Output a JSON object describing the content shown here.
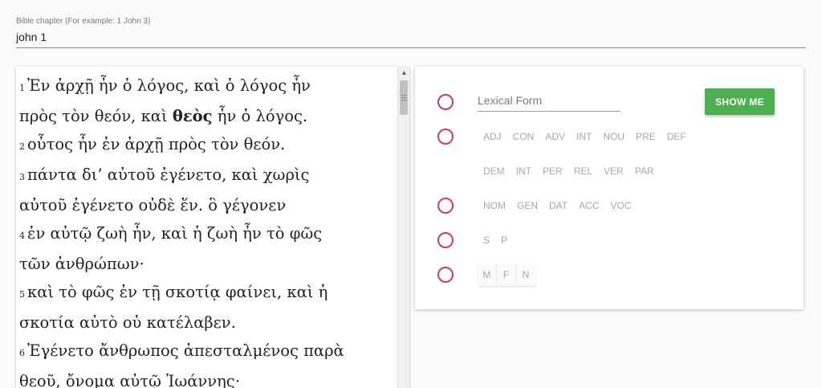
{
  "chapter": {
    "label": "Bible chapter (For example: 1 John 3)",
    "value": "john 1"
  },
  "verses": [
    {
      "number": "1",
      "lines": [
        {
          "words": [
            "Ἐν",
            "ἀρχῇ",
            "ἦν",
            "ὁ",
            "λόγος,",
            "καὶ",
            "ὁ",
            "λόγος",
            "ἦν"
          ]
        },
        {
          "words": [
            "πρὸς",
            "τὸν",
            "θεόν,",
            "καὶ"
          ],
          "bold": "θεὸς",
          "rest": [
            "ἦν",
            "ὁ",
            "λόγος."
          ]
        }
      ]
    },
    {
      "number": "2",
      "lines": [
        {
          "words": [
            "οὗτος",
            "ἦν",
            "ἐν",
            "ἀρχῇ",
            "πρὸς",
            "τὸν",
            "θεόν."
          ]
        }
      ]
    },
    {
      "number": "3",
      "lines": [
        {
          "words": [
            "πάντα",
            "δι’",
            "αὐτοῦ",
            "ἐγένετο,",
            "καὶ",
            "χωρὶς"
          ]
        },
        {
          "words": [
            "αὐτοῦ",
            "ἐγένετο",
            "οὐδὲ",
            "ἕν.",
            "ὃ",
            "γέγονεν"
          ]
        }
      ]
    },
    {
      "number": "4",
      "lines": [
        {
          "words": [
            "ἐν",
            "αὐτῷ",
            "ζωὴ",
            "ἦν,",
            "καὶ",
            "ἡ",
            "ζωὴ",
            "ἦν",
            "τὸ",
            "φῶς"
          ]
        },
        {
          "words": [
            "τῶν",
            "ἀνθρώπων·"
          ]
        }
      ]
    },
    {
      "number": "5",
      "lines": [
        {
          "words": [
            "καὶ",
            "τὸ",
            "φῶς",
            "ἐν",
            "τῇ",
            "σκοτίᾳ",
            "φαίνει,",
            "καὶ",
            "ἡ"
          ]
        },
        {
          "words": [
            "σκοτία",
            "αὐτὸ",
            "οὐ",
            "κατέλαβεν."
          ]
        }
      ]
    },
    {
      "number": "6",
      "lines": [
        {
          "words": [
            "Ἐγένετο",
            "ἄνθρωπος",
            "ἀπεσταλμένος",
            "παρὰ"
          ]
        },
        {
          "words": [
            "θεοῦ,",
            "ὄνομα",
            "αὐτῷ",
            "Ἰωάννης·"
          ]
        }
      ]
    }
  ],
  "filter": {
    "lexical_placeholder": "Lexical Form",
    "lexical_value": "",
    "show_button": "SHOW ME",
    "parts_of_speech_row1": [
      "ADJ",
      "CON",
      "ADV",
      "INT",
      "NOU",
      "PRE",
      "DEF"
    ],
    "parts_of_speech_row2": [
      "DEM",
      "INT",
      "PER",
      "REL",
      "VER",
      "PAR"
    ],
    "cases": [
      "NOM",
      "GEN",
      "DAT",
      "ACC",
      "VOC"
    ],
    "numbers": [
      "S",
      "P"
    ],
    "genders": [
      "M",
      "F",
      "N"
    ]
  },
  "colors": {
    "radio_accent": "#d2386c",
    "button_green": "#4caf50"
  }
}
